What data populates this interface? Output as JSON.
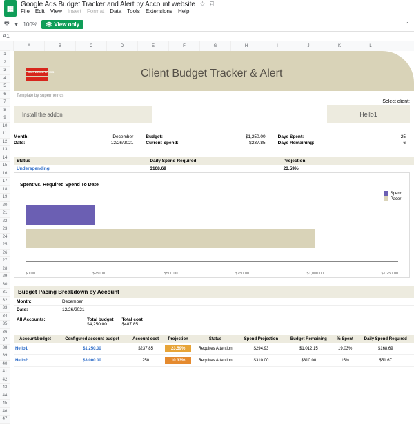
{
  "doc": {
    "title": "Google Ads Budget Tracker and Alert by Account website",
    "menus": [
      "File",
      "Edit",
      "View",
      "Insert",
      "Format",
      "Data",
      "Tools",
      "Extensions",
      "Help"
    ],
    "zoom": "100%",
    "view_only": "View only",
    "namebox": "A1"
  },
  "cols": [
    "",
    "A",
    "B",
    "C",
    "D",
    "E",
    "F",
    "G",
    "H",
    "I",
    "J",
    "K",
    "L"
  ],
  "rows_count": 47,
  "header": {
    "logo_text": "SUPERMETRICS",
    "hero": "Client Budget Tracker & Alert",
    "byline": "Template by supermetrics",
    "install": "Install the addon",
    "select_client_lbl": "Select client:",
    "client": "Hello1"
  },
  "metrics": {
    "month_lbl": "Month:",
    "month": "December",
    "date_lbl": "Date:",
    "date": "12/26/2021",
    "budget_lbl": "Budget:",
    "budget": "$1,250.00",
    "spend_lbl": "Current Spend:",
    "spend": "$237.85",
    "days_spent_lbl": "Days Spent:",
    "days_spent": "25",
    "days_rem_lbl": "Days Remaining:",
    "days_rem": "6"
  },
  "status": {
    "status_lbl": "Status",
    "status": "Underspending",
    "dsr_lbl": "Daily Spend Required",
    "dsr": "$168.69",
    "proj_lbl": "Projection",
    "proj": "23.59%"
  },
  "chart_data": {
    "type": "bar",
    "title": "Spent vs. Required Spend To Date",
    "orientation": "horizontal",
    "series": [
      {
        "name": "Spend",
        "color": "#6b5fb3",
        "values": [
          237.85
        ]
      },
      {
        "name": "Pacer",
        "color": "#d9d3b8",
        "values": [
          1008.06
        ]
      }
    ],
    "xlabel": "",
    "ylabel": "",
    "x_ticks": [
      "$0.00",
      "$250.00",
      "$500.00",
      "$750.00",
      "$1,000.00",
      "$1,250.00"
    ],
    "xlim": [
      0,
      1300
    ]
  },
  "section2": {
    "title": "Budget Pacing Breakdown by Account",
    "month_lbl": "Month:",
    "month": "December",
    "date_lbl": "Date:",
    "date": "12/26/2021",
    "all_lbl": "All Accounts:",
    "tb_lbl": "Total budget",
    "tb": "$4,250.00",
    "tc_lbl": "Total cost",
    "tc": "$487.85"
  },
  "table": {
    "headers": [
      "Account/budget",
      "Configured account budget",
      "Account cost",
      "Projection",
      "Status",
      "Spend Projection",
      "Budget Remaining",
      "% Spent",
      "Daily Spend Required"
    ],
    "rows": [
      {
        "acct": "Hello1",
        "conf": "$1,250.00",
        "cost": "$237.85",
        "proj": "23.59%",
        "proj_color": "#e7a437",
        "status": "Requires Attention",
        "sp": "$294.93",
        "br": "$1,012.15",
        "pct": "19.03%",
        "dsr": "$168.69"
      },
      {
        "acct": "Hello2",
        "conf": "$3,000.00",
        "cost": "250",
        "proj": "10.33%",
        "proj_color": "#e58a2e",
        "status": "Requires Attention",
        "sp": "$310.00",
        "br": "$310.00",
        "pct": "15%",
        "dsr": "$51.67"
      }
    ]
  }
}
